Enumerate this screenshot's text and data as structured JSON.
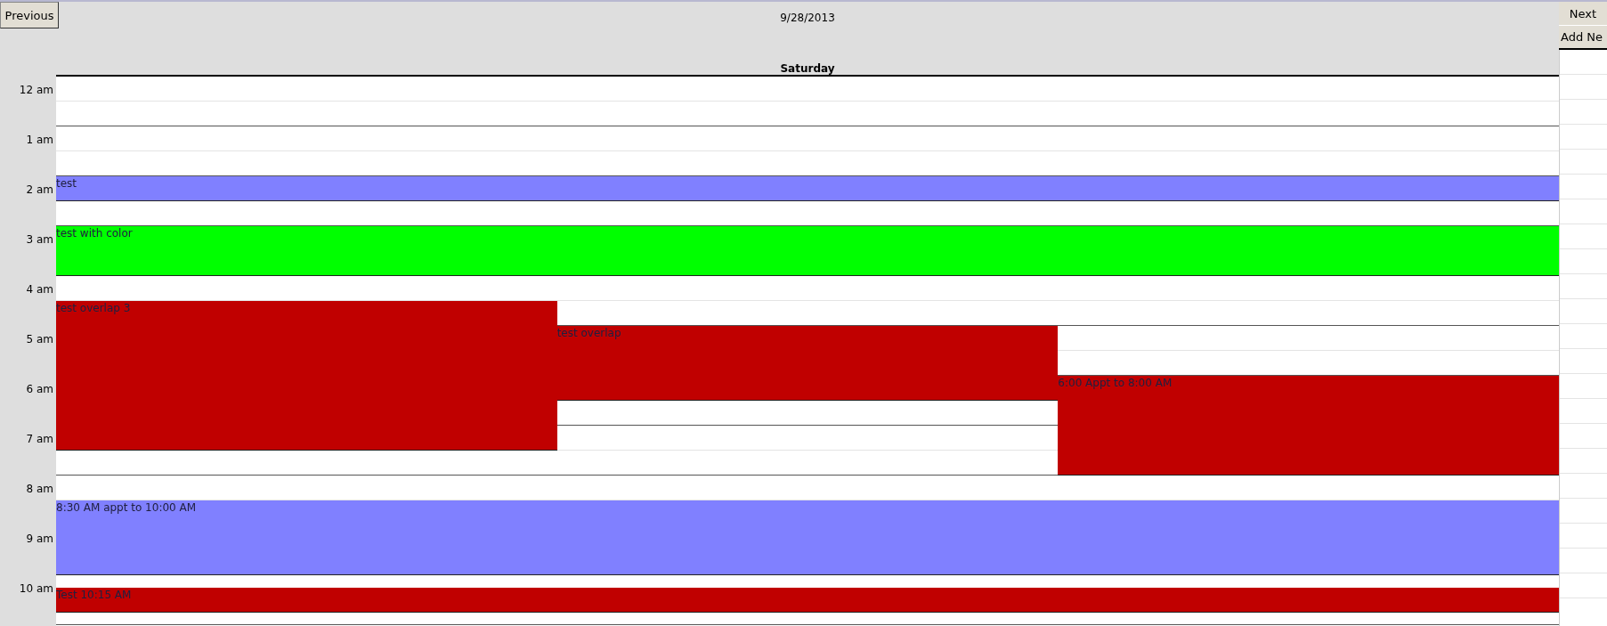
{
  "nav": {
    "previous": "Previous",
    "date": "9/28/2013",
    "next": "Next",
    "add": "Add Ne"
  },
  "day": {
    "name": "Saturday"
  },
  "hours": [
    "12 am",
    "1 am",
    "2 am",
    "3 am",
    "4 am",
    "5 am",
    "6 am",
    "7 am",
    "8 am",
    "9 am",
    "10 am"
  ],
  "quarter_hour_rows": [
    {
      "cells": [
        {
          "kind": "empty"
        }
      ]
    },
    {
      "cells": [
        {
          "kind": "empty"
        }
      ]
    },
    {
      "cells": [
        {
          "kind": "empty"
        }
      ]
    },
    {
      "cells": [
        {
          "kind": "empty"
        }
      ]
    },
    {
      "cells": [
        {
          "kind": "empty"
        }
      ]
    },
    {
      "cells": [
        {
          "kind": "empty"
        }
      ]
    },
    {
      "cells": [
        {
          "kind": "empty"
        }
      ]
    },
    {
      "cells": [
        {
          "kind": "empty"
        }
      ]
    },
    {
      "cells": [
        {
          "kind": "event-start",
          "title": "test",
          "color": "#8080ff"
        }
      ]
    },
    {
      "cells": [
        {
          "kind": "event"
        }
      ]
    },
    {
      "cells": [
        {
          "kind": "empty"
        }
      ]
    },
    {
      "cells": [
        {
          "kind": "empty"
        }
      ]
    },
    {
      "cells": [
        {
          "kind": "event-start",
          "title": "test with color",
          "color": "#00ff00"
        }
      ]
    },
    {
      "cells": [
        {
          "kind": "event"
        }
      ]
    },
    {
      "cells": [
        {
          "kind": "event"
        }
      ]
    },
    {
      "cells": [
        {
          "kind": "event"
        }
      ]
    },
    {
      "cells": [
        {
          "kind": "empty"
        }
      ]
    },
    {
      "cells": [
        {
          "kind": "empty"
        }
      ]
    },
    {
      "cells": [
        {
          "kind": "event-start",
          "title": "test overlap 3",
          "color": "#c00000"
        },
        {
          "kind": "empty"
        },
        {
          "kind": "empty"
        }
      ]
    },
    {
      "cells": [
        {
          "kind": "event"
        },
        {
          "kind": "empty"
        },
        {
          "kind": "empty"
        }
      ]
    },
    {
      "cells": [
        {
          "kind": "event"
        },
        {
          "kind": "event-start",
          "title": "test overlap",
          "color": "#c00000"
        },
        {
          "kind": "empty"
        }
      ]
    },
    {
      "cells": [
        {
          "kind": "event"
        },
        {
          "kind": "event"
        },
        {
          "kind": "empty"
        }
      ]
    },
    {
      "cells": [
        {
          "kind": "event"
        },
        {
          "kind": "event"
        },
        {
          "kind": "empty"
        }
      ]
    },
    {
      "cells": [
        {
          "kind": "event"
        },
        {
          "kind": "event"
        },
        {
          "kind": "empty"
        }
      ]
    },
    {
      "cells": [
        {
          "kind": "event"
        },
        {
          "kind": "event"
        },
        {
          "kind": "event-start",
          "title": "6:00 Appt to 8:00 AM",
          "color": "#c00000"
        }
      ]
    },
    {
      "cells": [
        {
          "kind": "event"
        },
        {
          "kind": "event"
        },
        {
          "kind": "event"
        }
      ]
    },
    {
      "cells": [
        {
          "kind": "event"
        },
        {
          "kind": "empty"
        },
        {
          "kind": "event"
        }
      ]
    },
    {
      "cells": [
        {
          "kind": "event"
        },
        {
          "kind": "empty"
        },
        {
          "kind": "event"
        }
      ]
    },
    {
      "cells": [
        {
          "kind": "event"
        },
        {
          "kind": "empty"
        },
        {
          "kind": "event"
        }
      ]
    },
    {
      "cells": [
        {
          "kind": "event"
        },
        {
          "kind": "empty"
        },
        {
          "kind": "event"
        }
      ]
    },
    {
      "cells": [
        {
          "kind": "empty"
        },
        {
          "kind": "empty"
        },
        {
          "kind": "event"
        }
      ]
    },
    {
      "cells": [
        {
          "kind": "empty"
        },
        {
          "kind": "empty"
        },
        {
          "kind": "event"
        }
      ]
    },
    {
      "cells": [
        {
          "kind": "empty"
        }
      ]
    },
    {
      "cells": [
        {
          "kind": "empty"
        }
      ]
    },
    {
      "cells": [
        {
          "kind": "event-start",
          "title": "8:30 AM appt to 10:00 AM",
          "color": "#8080ff"
        }
      ]
    },
    {
      "cells": [
        {
          "kind": "event"
        }
      ]
    },
    {
      "cells": [
        {
          "kind": "event"
        }
      ]
    },
    {
      "cells": [
        {
          "kind": "event"
        }
      ]
    },
    {
      "cells": [
        {
          "kind": "event"
        }
      ]
    },
    {
      "cells": [
        {
          "kind": "event"
        }
      ]
    },
    {
      "cells": [
        {
          "kind": "empty"
        }
      ]
    },
    {
      "cells": [
        {
          "kind": "event-start",
          "title": "Test 10:15 AM",
          "color": "#c00000"
        }
      ]
    },
    {
      "cells": [
        {
          "kind": "event"
        }
      ]
    },
    {
      "cells": [
        {
          "kind": "empty"
        }
      ]
    }
  ]
}
